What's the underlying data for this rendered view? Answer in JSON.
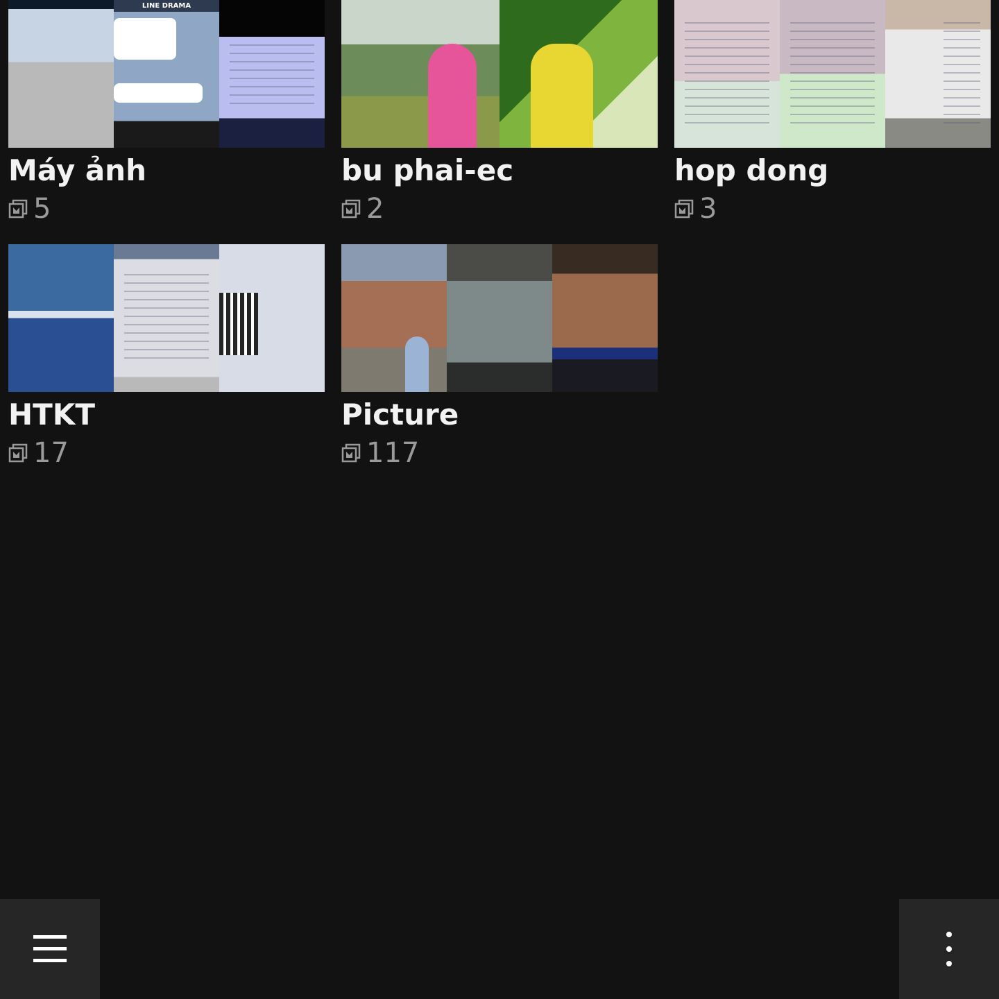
{
  "albums": [
    {
      "name": "Máy ảnh",
      "count": "5",
      "chat_header": "LINE DRAMA"
    },
    {
      "name": "bu phai-ec",
      "count": "2"
    },
    {
      "name": "hop dong",
      "count": "3"
    },
    {
      "name": "HTKT",
      "count": "17"
    },
    {
      "name": "Picture",
      "count": "117"
    }
  ],
  "icons": {
    "album_count": "photo-stack-icon",
    "menu": "hamburger-menu-icon",
    "overflow": "more-vertical-icon"
  },
  "colors": {
    "background": "#121212",
    "bottom_button": "#262626",
    "count_text": "#9a9a9a"
  }
}
